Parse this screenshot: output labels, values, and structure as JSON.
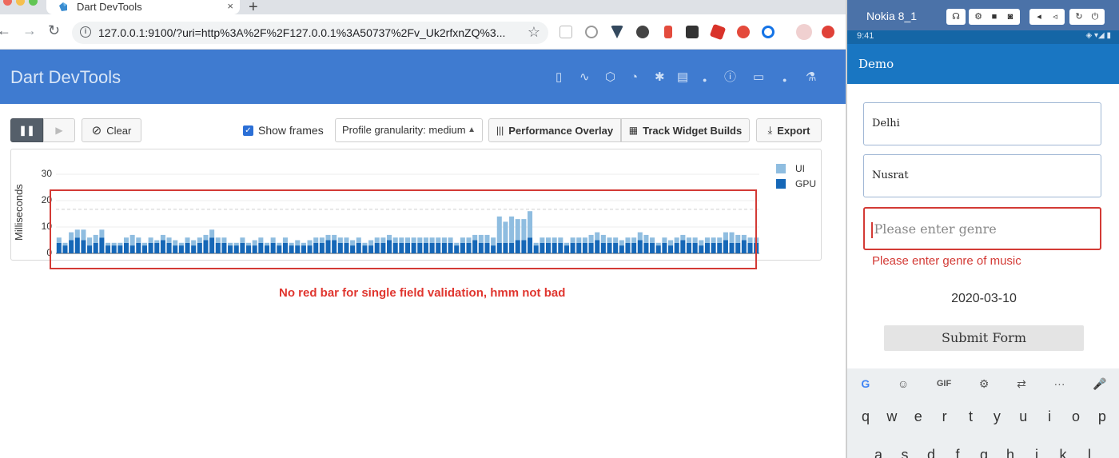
{
  "browser": {
    "tab_title": "Dart DevTools",
    "tab_close": "×",
    "new_tab": "+",
    "url": "127.0.0.1:9100/?uri=http%3A%2F%2F127.0.0.1%3A50737%2Fv_Uk2rfxnZQ%3...",
    "nav_back": "←",
    "nav_forward": "→",
    "nav_reload": "↻",
    "bookmark": "☆"
  },
  "devtools": {
    "title": "Dart DevTools",
    "header_icons": [
      "device-icon",
      "pulse-icon",
      "cube-icon",
      "timer-icon",
      "bug-icon",
      "clipboard-icon",
      "dot-icon",
      "info-icon",
      "comment-icon",
      "dot-icon",
      "flask-icon"
    ],
    "clear_label": "Clear",
    "show_frames_label": "Show frames",
    "granularity_label": "Profile granularity: medium",
    "performance_overlay_label": "Performance Overlay",
    "track_widget_builds_label": "Track Widget Builds",
    "export_label": "Export",
    "annotation": "No red bar for single field validation, hmm not bad",
    "colors": {
      "header": "#3f7bd0",
      "ui": "#8fbde0",
      "gpu": "#1567b7",
      "highlight": "#d33a35"
    }
  },
  "chart_data": {
    "type": "bar",
    "ylabel": "Milliseconds",
    "yticks": [
      "30",
      "20",
      "10",
      "0"
    ],
    "ylim": [
      0,
      30
    ],
    "legend": [
      "UI",
      "GPU"
    ],
    "stacked": true,
    "series": [
      {
        "name": "GPU",
        "values": [
          4,
          3,
          5,
          6,
          5,
          3,
          4,
          6,
          3,
          3,
          3,
          4,
          3,
          4,
          3,
          4,
          4,
          5,
          4,
          3,
          3,
          4,
          3,
          4,
          5,
          6,
          4,
          4,
          3,
          3,
          4,
          3,
          3,
          4,
          3,
          4,
          3,
          4,
          3,
          3,
          3,
          3,
          4,
          4,
          5,
          5,
          4,
          4,
          3,
          4,
          3,
          3,
          4,
          4,
          5,
          4,
          4,
          4,
          4,
          4,
          4,
          4,
          4,
          4,
          4,
          3,
          4,
          4,
          5,
          4,
          4,
          3,
          4,
          4,
          4,
          5,
          5,
          6,
          3,
          4,
          4,
          4,
          4,
          3,
          4,
          4,
          4,
          4,
          5,
          4,
          4,
          4,
          3,
          4,
          4,
          5,
          4,
          4,
          3,
          4,
          3,
          4,
          5,
          4,
          4,
          3,
          4,
          4,
          4,
          5,
          4,
          4,
          5,
          4,
          4
        ]
      },
      {
        "name": "UI",
        "values": [
          2,
          1,
          3,
          3,
          4,
          3,
          3,
          3,
          1,
          1,
          1,
          2,
          4,
          2,
          1,
          2,
          1,
          2,
          2,
          2,
          1,
          2,
          2,
          2,
          2,
          3,
          2,
          2,
          1,
          1,
          2,
          1,
          2,
          2,
          1,
          2,
          1,
          2,
          1,
          2,
          1,
          2,
          2,
          2,
          2,
          2,
          2,
          2,
          2,
          2,
          1,
          2,
          2,
          2,
          2,
          2,
          2,
          2,
          2,
          2,
          2,
          2,
          2,
          2,
          2,
          1,
          2,
          2,
          2,
          3,
          3,
          3,
          10,
          8,
          10,
          8,
          8,
          10,
          1,
          2,
          2,
          2,
          2,
          1,
          2,
          2,
          2,
          3,
          3,
          3,
          2,
          2,
          2,
          2,
          2,
          3,
          3,
          2,
          1,
          2,
          2,
          2,
          2,
          2,
          2,
          2,
          2,
          2,
          2,
          3,
          4,
          3,
          2,
          2,
          2
        ]
      }
    ]
  },
  "phone": {
    "device_name": "Nokia 8_1",
    "emu_controls_1": [
      "headset-icon"
    ],
    "emu_controls_2": [
      "settings-icon",
      "video-icon",
      "camera-icon"
    ],
    "emu_controls_3": [
      "volume-down-icon",
      "volume-up-icon"
    ],
    "emu_controls_4": [
      "rotate-icon",
      "power-icon"
    ],
    "time": "9:41",
    "status_icons": "◈ ▾◢ ▮",
    "app_title": "Demo",
    "field1_value": "Delhi",
    "field2_value": "Nusrat",
    "field3_placeholder": "Please enter genre",
    "field3_error": "Please enter genre of music",
    "date": "2020-03-10",
    "submit_label": "Submit Form",
    "kb_top": [
      "G",
      "☺",
      "GIF",
      "⚙",
      "⇄",
      "···",
      "🎤"
    ],
    "kb_row1": [
      "q",
      "w",
      "e",
      "r",
      "t",
      "y",
      "u",
      "i",
      "o",
      "p"
    ],
    "kb_row2": [
      "a",
      "s",
      "d",
      "f",
      "g",
      "h",
      "j",
      "k",
      "l"
    ]
  }
}
